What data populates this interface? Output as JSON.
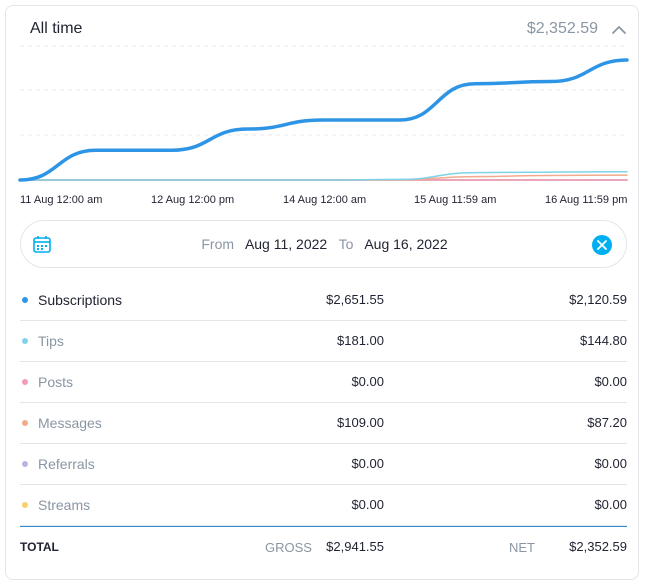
{
  "header": {
    "title": "All time",
    "total": "$2,352.59"
  },
  "chart_data": {
    "type": "line",
    "x_ticks": [
      "11 Aug 12:00 am",
      "12 Aug 12:00 pm",
      "14 Aug 12:00 am",
      "15 Aug 11:59 am",
      "16 Aug 11:59 pm"
    ],
    "series": [
      {
        "name": "Subscriptions",
        "color": "#2e95e6",
        "values": [
          0,
          525,
          525,
          900,
          1060,
          1060,
          1700,
          1740,
          2120
        ]
      },
      {
        "name": "Tips",
        "color": "#7fd3e8",
        "values": [
          0,
          0,
          0,
          0,
          0,
          10,
          130,
          140,
          145
        ]
      },
      {
        "name": "Messages",
        "color": "#f3a98b",
        "values": [
          0,
          0,
          0,
          0,
          0,
          5,
          60,
          80,
          87
        ]
      },
      {
        "name": "Posts",
        "color": "#f29ab5",
        "values": [
          0,
          0,
          0,
          0,
          0,
          0,
          0,
          0,
          0
        ]
      },
      {
        "name": "Referrals",
        "color": "#b9b3e0",
        "values": [
          0,
          0,
          0,
          0,
          0,
          0,
          0,
          0,
          0
        ]
      },
      {
        "name": "Streams",
        "color": "#f7cf6b",
        "values": [
          0,
          0,
          0,
          0,
          0,
          0,
          0,
          0,
          0
        ]
      }
    ],
    "grid": true
  },
  "range": {
    "from_label": "From",
    "from_value": "Aug 11, 2022",
    "to_label": "To",
    "to_value": "Aug 16, 2022"
  },
  "rows": [
    {
      "name": "Subscriptions",
      "gross": "$2,651.55",
      "net": "$2,120.59",
      "color": "#2e95e6",
      "text_color": "#1f2230"
    },
    {
      "name": "Tips",
      "gross": "$181.00",
      "net": "$144.80",
      "color": "#7fd3e8",
      "text_color": "#8a96a3"
    },
    {
      "name": "Posts",
      "gross": "$0.00",
      "net": "$0.00",
      "color": "#f29ab5",
      "text_color": "#8a96a3"
    },
    {
      "name": "Messages",
      "gross": "$109.00",
      "net": "$87.20",
      "color": "#f3a98b",
      "text_color": "#8a96a3"
    },
    {
      "name": "Referrals",
      "gross": "$0.00",
      "net": "$0.00",
      "color": "#b9b3e0",
      "text_color": "#8a96a3"
    },
    {
      "name": "Streams",
      "gross": "$0.00",
      "net": "$0.00",
      "color": "#f7cf6b",
      "text_color": "#8a96a3"
    }
  ],
  "total": {
    "label": "TOTAL",
    "gross_label": "GROSS",
    "gross": "$2,941.55",
    "net_label": "NET",
    "net": "$2,352.59"
  }
}
